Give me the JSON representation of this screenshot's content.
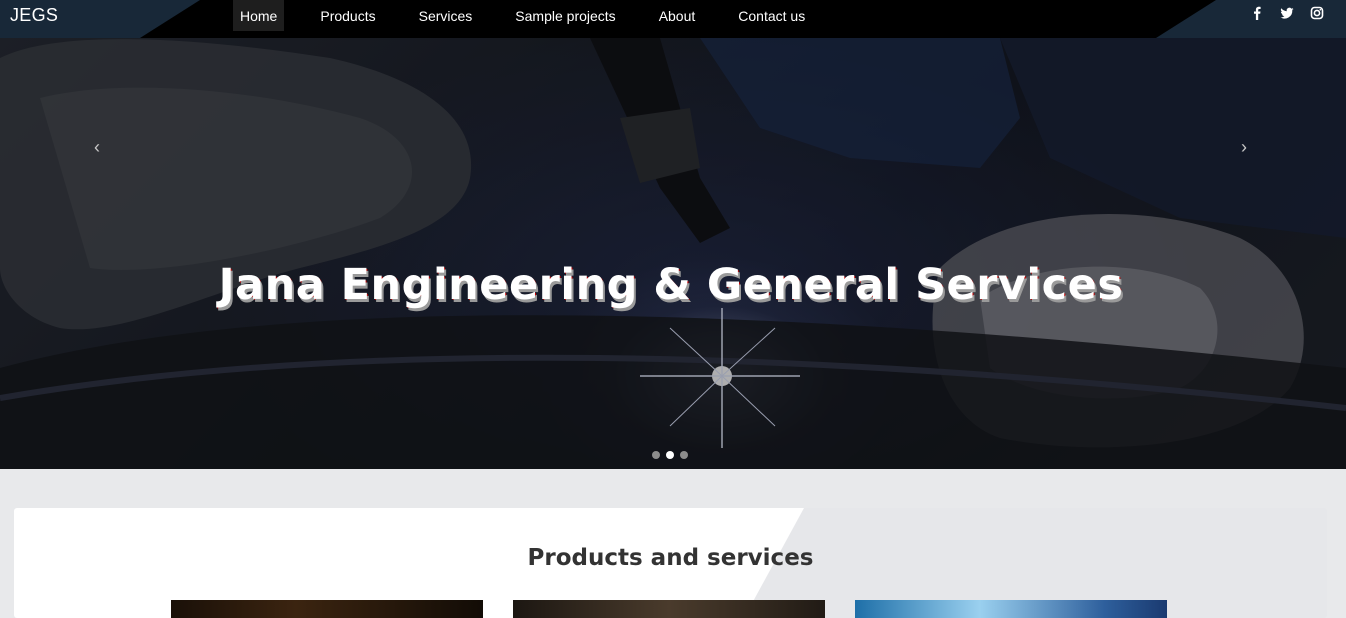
{
  "nav": {
    "brand": "JEGS",
    "links": [
      {
        "label": "Home",
        "active": true
      },
      {
        "label": "Products",
        "active": false
      },
      {
        "label": "Services",
        "active": false
      },
      {
        "label": "Sample projects",
        "active": false
      },
      {
        "label": "About",
        "active": false
      },
      {
        "label": "Contact us",
        "active": false
      }
    ],
    "social": [
      "facebook-icon",
      "twitter-icon",
      "instagram-icon"
    ]
  },
  "hero": {
    "title": "Jana Engineering & General Services",
    "prev_glyph": "‹",
    "next_glyph": "›",
    "slide_count": 3,
    "active_slide": 2
  },
  "section": {
    "title": "Products and services"
  },
  "colors": {
    "nav_bg": "#000000",
    "nav_accent": "#182838",
    "page_bg": "#e9eaec",
    "card_bg": "#ffffff"
  }
}
